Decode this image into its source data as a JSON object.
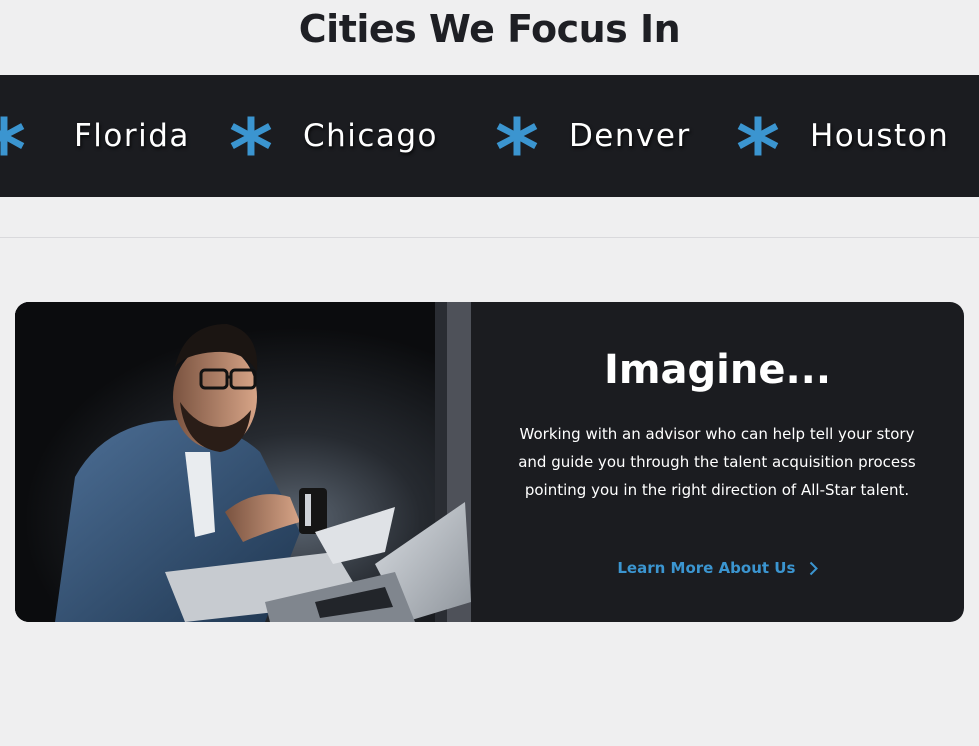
{
  "section": {
    "title": "Cities We Focus In"
  },
  "ticker": {
    "items": [
      {
        "icon": "asterisk-icon",
        "label": "Florida"
      },
      {
        "icon": "asterisk-icon",
        "label": "Chicago"
      },
      {
        "icon": "asterisk-icon",
        "label": "Denver"
      },
      {
        "icon": "asterisk-icon",
        "label": "Houston"
      }
    ],
    "accent_color": "#3b95d0",
    "background_color": "#1b1c20"
  },
  "card": {
    "heading": "Imagine...",
    "body": "Working with an advisor who can help tell your story and guide you through the talent acquisition process pointing you in the right direction of All-Star talent.",
    "link_label": "Learn More About Us",
    "link_icon": "chevron-right-icon",
    "link_color": "#3b95d0",
    "image": "man-with-laptop-and-coffee-photo"
  },
  "colors": {
    "page_background": "#efeff0",
    "heading_text": "#1e1f24"
  }
}
